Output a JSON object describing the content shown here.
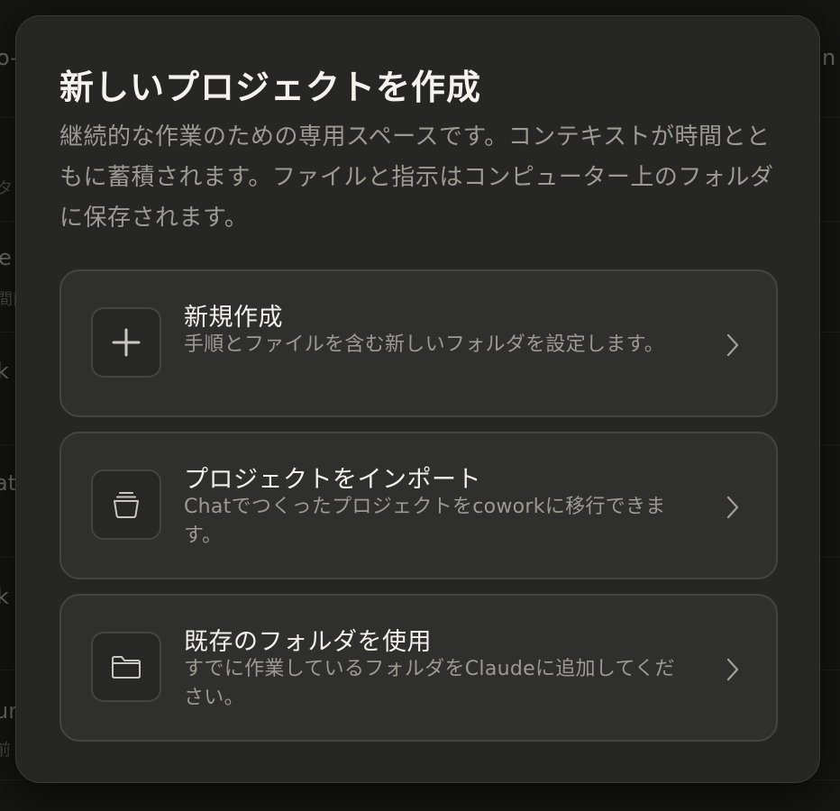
{
  "background": {
    "fragments": [
      "o-",
      "n",
      "タ",
      "e",
      "間前",
      "k",
      "at",
      "k",
      "ur",
      "前"
    ]
  },
  "modal": {
    "title": "新しいプロジェクトを作成",
    "description": "継続的な作業のための専用スペースです。コンテキストが時間とともに蓄積されます。ファイルと指示はコンピューター上のフォルダに保存されます。",
    "options": [
      {
        "title": "新規作成",
        "description": "手順とファイルを含む新しいフォルダを設定します。",
        "icon": "plus-icon"
      },
      {
        "title": "プロジェクトをインポート",
        "description": "Chatでつくったプロジェクトをcoworkに移行できます。",
        "icon": "archive-icon"
      },
      {
        "title": "既存のフォルダを使用",
        "description": "すでに作業しているフォルダをClaudeに追加してください。",
        "icon": "folder-icon"
      }
    ]
  },
  "colors": {
    "modal_bg": "#262625",
    "card_bg": "#2f2f2d",
    "border": "#444441",
    "title_text": "#f4f3ee",
    "muted_text": "#9c9a93"
  }
}
